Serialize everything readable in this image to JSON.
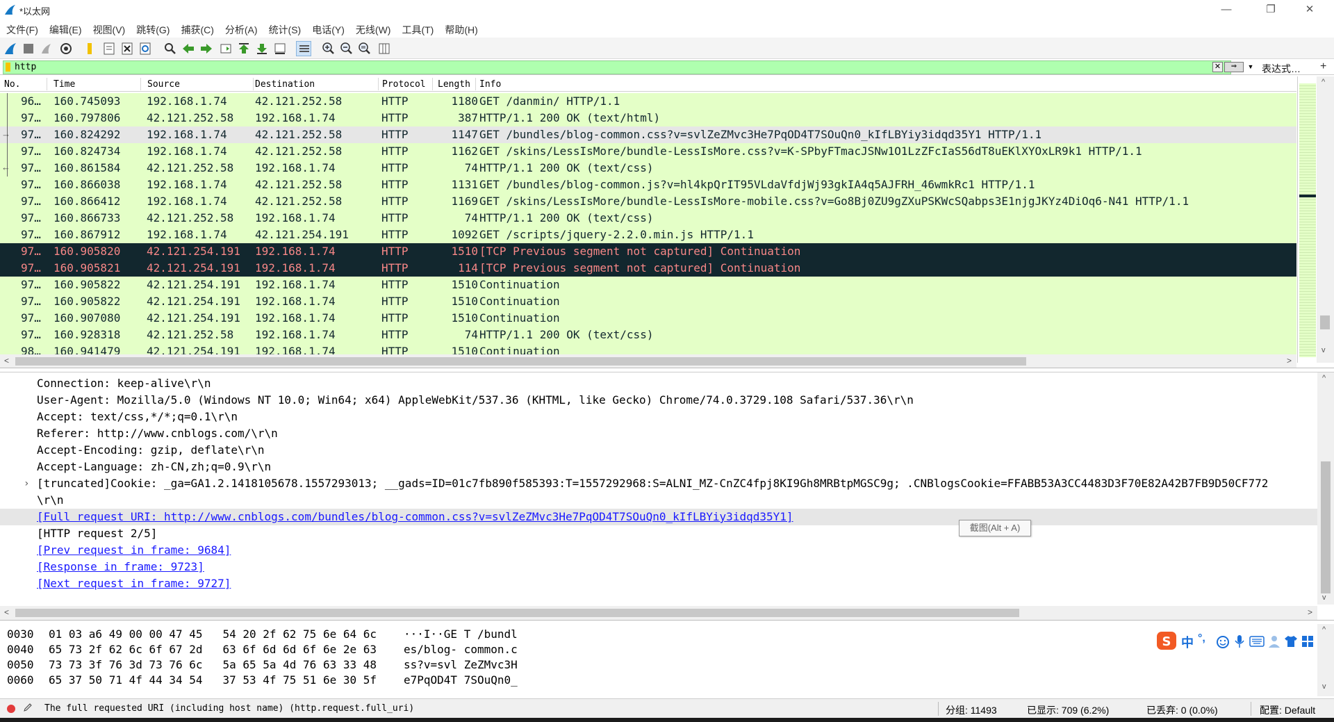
{
  "window": {
    "title": "*以太网",
    "controls": {
      "minimize": "—",
      "restore": "❐",
      "close": "✕"
    }
  },
  "menu": [
    "文件(F)",
    "编辑(E)",
    "视图(V)",
    "跳转(G)",
    "捕获(C)",
    "分析(A)",
    "统计(S)",
    "电话(Y)",
    "无线(W)",
    "工具(T)",
    "帮助(H)"
  ],
  "toolbar": {
    "icons": [
      "shark-fin-start-icon",
      "stop-capture-icon",
      "restart-capture-icon",
      "capture-options-icon",
      "open-file-icon",
      "save-file-icon",
      "close-file-icon",
      "reload-icon",
      "find-packet-icon",
      "go-back-icon",
      "go-forward-icon",
      "go-to-packet-icon",
      "first-packet-icon",
      "last-packet-icon",
      "auto-scroll-icon",
      "colorize-icon",
      "zoom-in-icon",
      "zoom-out-icon",
      "normal-size-icon",
      "resize-columns-icon"
    ]
  },
  "filter": {
    "value": "http",
    "expression_label": "表达式…",
    "plus": "+"
  },
  "columns": [
    "No.",
    "Time",
    "Source",
    "Destination",
    "Protocol",
    "Length",
    "Info"
  ],
  "packets": [
    {
      "no": "96…",
      "time": "160.745093",
      "src": "192.168.1.74",
      "dst": "42.121.252.58",
      "proto": "HTTP",
      "len": "1180",
      "info": "GET /danmin/ HTTP/1.1",
      "style": "http"
    },
    {
      "no": "97…",
      "time": "160.797806",
      "src": "42.121.252.58",
      "dst": "192.168.1.74",
      "proto": "HTTP",
      "len": "387",
      "info": "HTTP/1.1 200 OK  (text/html)",
      "style": "http"
    },
    {
      "no": "97…",
      "time": "160.824292",
      "src": "192.168.1.74",
      "dst": "42.121.252.58",
      "proto": "HTTP",
      "len": "1147",
      "info": "GET /bundles/blog-common.css?v=svlZeZMvc3He7PqOD4T7SOuQn0_kIfLBYiy3idqd35Y1 HTTP/1.1",
      "style": "sel"
    },
    {
      "no": "97…",
      "time": "160.824734",
      "src": "192.168.1.74",
      "dst": "42.121.252.58",
      "proto": "HTTP",
      "len": "1162",
      "info": "GET /skins/LessIsMore/bundle-LessIsMore.css?v=K-SPbyFTmacJSNw1O1LzZFcIaS56dT8uEKlXYOxLR9k1 HTTP/1.1",
      "style": "http"
    },
    {
      "no": "97…",
      "time": "160.861584",
      "src": "42.121.252.58",
      "dst": "192.168.1.74",
      "proto": "HTTP",
      "len": "74",
      "info": "HTTP/1.1 200 OK  (text/css)",
      "style": "http"
    },
    {
      "no": "97…",
      "time": "160.866038",
      "src": "192.168.1.74",
      "dst": "42.121.252.58",
      "proto": "HTTP",
      "len": "1131",
      "info": "GET /bundles/blog-common.js?v=hl4kpQrIT95VLdaVfdjWj93gkIA4q5AJFRH_46wmkRc1 HTTP/1.1",
      "style": "http"
    },
    {
      "no": "97…",
      "time": "160.866412",
      "src": "192.168.1.74",
      "dst": "42.121.252.58",
      "proto": "HTTP",
      "len": "1169",
      "info": "GET /skins/LessIsMore/bundle-LessIsMore-mobile.css?v=Go8Bj0ZU9gZXuPSKWcSQabps3E1njgJKYz4DiOq6-N41 HTTP/1.1",
      "style": "http"
    },
    {
      "no": "97…",
      "time": "160.866733",
      "src": "42.121.252.58",
      "dst": "192.168.1.74",
      "proto": "HTTP",
      "len": "74",
      "info": "HTTP/1.1 200 OK  (text/css)",
      "style": "http"
    },
    {
      "no": "97…",
      "time": "160.867912",
      "src": "192.168.1.74",
      "dst": "42.121.254.191",
      "proto": "HTTP",
      "len": "1092",
      "info": "GET /scripts/jquery-2.2.0.min.js HTTP/1.1",
      "style": "http"
    },
    {
      "no": "97…",
      "time": "160.905820",
      "src": "42.121.254.191",
      "dst": "192.168.1.74",
      "proto": "HTTP",
      "len": "1510",
      "info": "[TCP Previous segment not captured] Continuation",
      "style": "err"
    },
    {
      "no": "97…",
      "time": "160.905821",
      "src": "42.121.254.191",
      "dst": "192.168.1.74",
      "proto": "HTTP",
      "len": "114",
      "info": "[TCP Previous segment not captured] Continuation",
      "style": "err"
    },
    {
      "no": "97…",
      "time": "160.905822",
      "src": "42.121.254.191",
      "dst": "192.168.1.74",
      "proto": "HTTP",
      "len": "1510",
      "info": "Continuation",
      "style": "http"
    },
    {
      "no": "97…",
      "time": "160.905822",
      "src": "42.121.254.191",
      "dst": "192.168.1.74",
      "proto": "HTTP",
      "len": "1510",
      "info": "Continuation",
      "style": "http"
    },
    {
      "no": "97…",
      "time": "160.907080",
      "src": "42.121.254.191",
      "dst": "192.168.1.74",
      "proto": "HTTP",
      "len": "1510",
      "info": "Continuation",
      "style": "http"
    },
    {
      "no": "97…",
      "time": "160.928318",
      "src": "42.121.252.58",
      "dst": "192.168.1.74",
      "proto": "HTTP",
      "len": "74",
      "info": "HTTP/1.1 200 OK  (text/css)",
      "style": "http"
    },
    {
      "no": "98…",
      "time": "160.941479",
      "src": "42.121.254.191",
      "dst": "192.168.1.74",
      "proto": "HTTP",
      "len": "1510",
      "info": "Continuation",
      "style": "http"
    }
  ],
  "details": [
    {
      "text": "Connection: keep-alive\\r\\n",
      "kind": "plain"
    },
    {
      "text": "User-Agent: Mozilla/5.0 (Windows NT 10.0; Win64; x64) AppleWebKit/537.36 (KHTML, like Gecko) Chrome/74.0.3729.108 Safari/537.36\\r\\n",
      "kind": "plain"
    },
    {
      "text": "Accept: text/css,*/*;q=0.1\\r\\n",
      "kind": "plain"
    },
    {
      "text": "Referer: http://www.cnblogs.com/\\r\\n",
      "kind": "plain"
    },
    {
      "text": "Accept-Encoding: gzip, deflate\\r\\n",
      "kind": "plain"
    },
    {
      "text": "Accept-Language: zh-CN,zh;q=0.9\\r\\n",
      "kind": "plain"
    },
    {
      "text": " [truncated]Cookie: _ga=GA1.2.1418105678.1557293013; __gads=ID=01c7fb890f585393:T=1557292968:S=ALNI_MZ-CnZC4fpj8KI9Gh8MRBtpMGSC9g; .CNBlogsCookie=FFABB53A3CC4483D3F70E82A42B7FB9D50CF772",
      "kind": "expandable"
    },
    {
      "text": "\\r\\n",
      "kind": "plain"
    },
    {
      "text": "[Full request URI: http://www.cnblogs.com/bundles/blog-common.css?v=svlZeZMvc3He7PqOD4T7SOuQn0_kIfLBYiy3idqd35Y1]",
      "kind": "link-hl"
    },
    {
      "text": "[HTTP request 2/5]",
      "kind": "plain"
    },
    {
      "text": "[Prev request in frame: 9684]",
      "kind": "link"
    },
    {
      "text": "[Response in frame: 9723]",
      "kind": "link"
    },
    {
      "text": "[Next request in frame: 9727]",
      "kind": "link"
    }
  ],
  "tooltip": "截图(Alt + A)",
  "bytes": [
    {
      "offset": "0030",
      "hex": "01 03 a6 49 00 00 47 45   54 20 2f 62 75 6e 64 6c",
      "ascii": "···I··GE T /bundl"
    },
    {
      "offset": "0040",
      "hex": "65 73 2f 62 6c 6f 67 2d   63 6f 6d 6d 6f 6e 2e 63",
      "ascii": "es/blog- common.c"
    },
    {
      "offset": "0050",
      "hex": "73 73 3f 76 3d 73 76 6c   5a 65 5a 4d 76 63 33 48",
      "ascii": "ss?v=svl ZeZMvc3H"
    },
    {
      "offset": "0060",
      "hex": "65 37 50 71 4f 44 34 54   37 53 4f 75 51 6e 30 5f",
      "ascii": "e7PqOD4T 7SOuQn0_"
    }
  ],
  "ime": {
    "label": "中",
    "punct": "°,",
    "icons": [
      "sogou-s-icon",
      "emoji-icon",
      "microphone-icon",
      "keyboard-icon",
      "user-icon",
      "shirt-icon",
      "grid-icon"
    ]
  },
  "status": {
    "text": "The full requested URI (including host name) (http.request.full_uri)",
    "packets": "分组: 11493",
    "displayed": "已显示: 709 (6.2%)",
    "dropped": "已丢弃: 0 (0.0%)",
    "profile": "配置: Default"
  },
  "colors": {
    "http_row": "#e4ffc7",
    "error_row_bg": "#12272e",
    "error_row_fg": "#f78787",
    "filter_ok": "#afffaf",
    "link": "#1a1aff"
  }
}
